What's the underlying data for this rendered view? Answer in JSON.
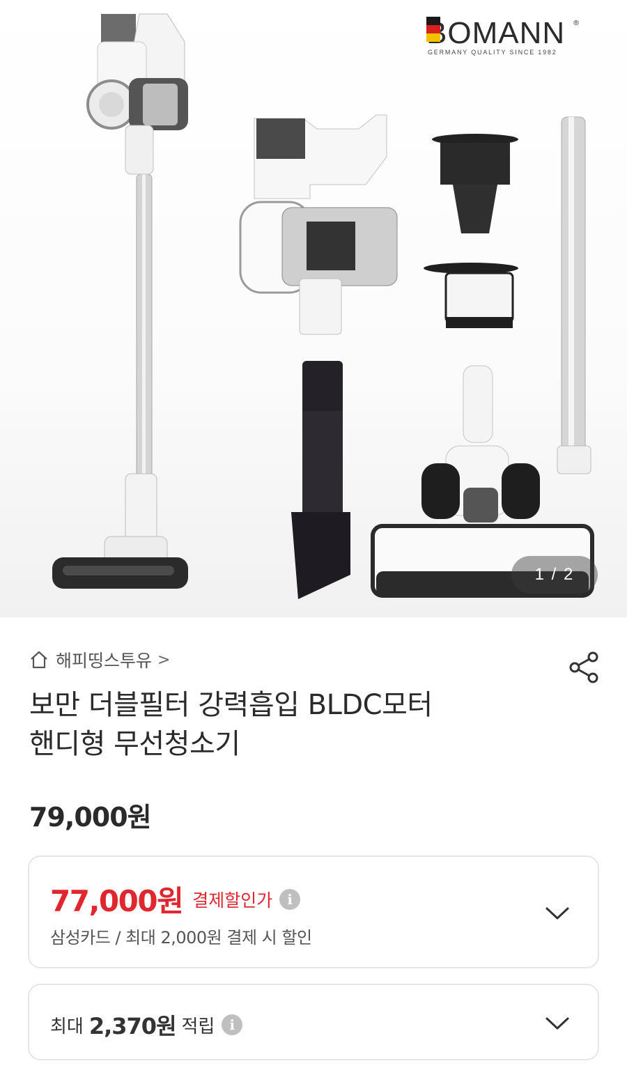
{
  "brand": {
    "name": "BOMANN",
    "registered": "®",
    "tagline": "GERMANY QUALITY SINCE 1982"
  },
  "gallery": {
    "counter": "1 / 2"
  },
  "store": {
    "name": "해피띵스투유",
    "arrow": ">"
  },
  "product": {
    "title_line1": "보만 더블필터 강력흡입 BLDC모터",
    "title_line2": "핸디형 무선청소기",
    "price": "79,000원"
  },
  "payment_discount": {
    "price": "77,000원",
    "label": "결제할인가",
    "info": "i",
    "description": "삼성카드 / 최대 2,000원 결제 시 할인"
  },
  "points": {
    "prefix": "최대",
    "amount": "2,370원",
    "suffix": "적립",
    "info": "i"
  },
  "colors": {
    "sale_red": "#e0262f",
    "border": "#e6e6e6",
    "info_gray": "#bfbfbf"
  },
  "icons": [
    "home-icon",
    "share-icon",
    "info-icon",
    "chevron-down-icon"
  ]
}
